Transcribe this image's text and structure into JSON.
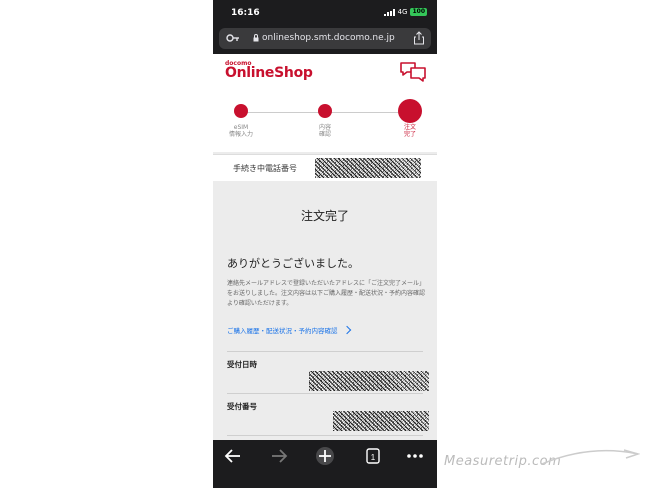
{
  "status": {
    "time": "16:16",
    "network": "4G",
    "battery": "100"
  },
  "browser": {
    "url": "onlineshop.smt.docomo.ne.jp"
  },
  "header": {
    "brand_small": "docomo",
    "brand_main": "OnlineShop"
  },
  "steps": [
    {
      "line1": "eSIM",
      "line2": "情報入力",
      "state": "done"
    },
    {
      "line1": "内容",
      "line2": "確認",
      "state": "done"
    },
    {
      "line1": "注文",
      "line2": "完了",
      "state": "current"
    }
  ],
  "phone_number_row": {
    "label": "手続き中電話番号"
  },
  "main": {
    "title": "注文完了",
    "thanks": "ありがとうございました。",
    "description": "連絡先メールアドレスで登録いただいたアドレスに「ご注文完了メール」をお送りしました。注文内容は以下ご購入履歴・配送状況・予約内容確認より確認いただけます。",
    "history_link": "ご購入履歴・配送状況・予約内容確認",
    "fields": [
      {
        "label": "受付日時"
      },
      {
        "label": "受付番号"
      }
    ]
  },
  "watermark": "Measuretrip.com",
  "colors": {
    "brand": "#c8102e",
    "link": "#1a73e8",
    "chrome": "#1c1c1e"
  }
}
